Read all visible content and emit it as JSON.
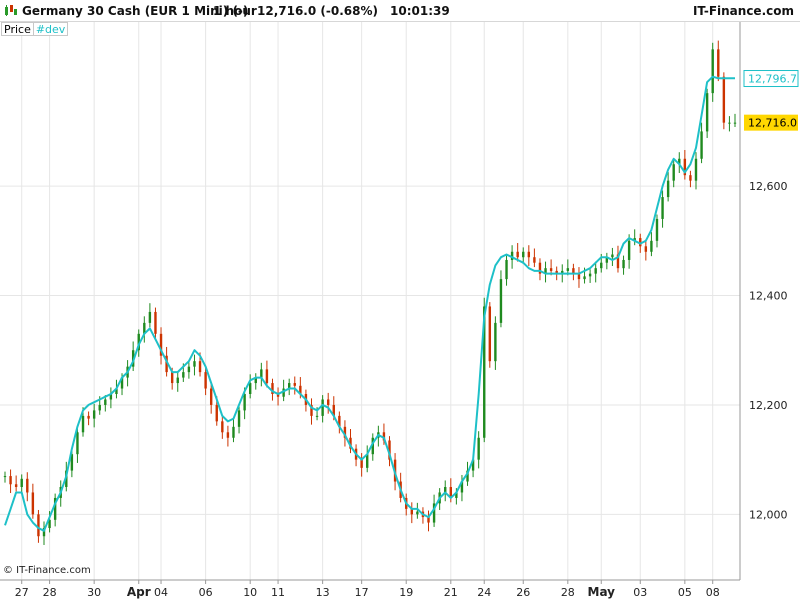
{
  "header": {
    "instrument": "Germany 30 Cash (EUR 1 Mini) (-)",
    "timeframe": "1 hour",
    "quote": "12,716.0 (-0.68%)",
    "time": "10:01:39",
    "brand": "IT-Finance.com"
  },
  "legend": {
    "price_label": "Price",
    "indicator_label": "#dev"
  },
  "footer": {
    "copyright": "© IT-Finance.com"
  },
  "colors": {
    "up": "#1f8a1f",
    "down": "#cc3300",
    "indicator": "#1ec0c8",
    "last_price_bg": "#ffd700",
    "grid": "#e6e6e6"
  },
  "chart_data": {
    "type": "line",
    "ylim": [
      11880,
      12900
    ],
    "y_ticks": [
      12000,
      12200,
      12400,
      12600
    ],
    "y_tick_labels": [
      "12,000",
      "12,200",
      "12,400",
      "12,600"
    ],
    "last_price": 12716.0,
    "last_price_label": "12,716.0",
    "indicator_value": 12796.7,
    "indicator_label": "12,796.7",
    "x_tick_labels": [
      "27",
      "28",
      "30",
      "Apr",
      "04",
      "06",
      "10",
      "11",
      "13",
      "17",
      "19",
      "21",
      "24",
      "26",
      "28",
      "May",
      "03",
      "05",
      "08"
    ],
    "x_tick_bold": [
      false,
      false,
      false,
      true,
      false,
      false,
      false,
      false,
      false,
      false,
      false,
      false,
      false,
      false,
      false,
      true,
      false,
      false,
      false
    ],
    "x_tick_index": [
      3,
      8,
      16,
      24,
      28,
      36,
      44,
      49,
      57,
      64,
      72,
      80,
      86,
      93,
      101,
      107,
      114,
      122,
      127
    ],
    "x_count": 132,
    "price_series": [
      12070,
      12055,
      12050,
      12065,
      12040,
      12000,
      11960,
      11975,
      11990,
      12030,
      12050,
      12080,
      12110,
      12150,
      12180,
      12175,
      12190,
      12200,
      12210,
      12220,
      12230,
      12250,
      12270,
      12300,
      12330,
      12350,
      12370,
      12330,
      12290,
      12260,
      12240,
      12250,
      12260,
      12270,
      12280,
      12260,
      12230,
      12200,
      12170,
      12150,
      12140,
      12160,
      12190,
      12220,
      12240,
      12250,
      12265,
      12240,
      12220,
      12215,
      12230,
      12240,
      12235,
      12220,
      12200,
      12180,
      12180,
      12210,
      12200,
      12180,
      12160,
      12140,
      12120,
      12100,
      12085,
      12110,
      12140,
      12150,
      12135,
      12100,
      12060,
      12030,
      12010,
      12000,
      12005,
      11995,
      11985,
      12020,
      12040,
      12050,
      12030,
      12040,
      12060,
      12080,
      12100,
      12140,
      12380,
      12280,
      12350,
      12430,
      12465,
      12480,
      12470,
      12480,
      12470,
      12460,
      12440,
      12450,
      12445,
      12440,
      12445,
      12450,
      12440,
      12430,
      12435,
      12440,
      12450,
      12460,
      12470,
      12475,
      12450,
      12465,
      12500,
      12505,
      12490,
      12480,
      12500,
      12540,
      12580,
      12610,
      12640,
      12650,
      12620,
      12610,
      12650,
      12700,
      12770,
      12850,
      12800,
      12716,
      12716,
      12716
    ],
    "indicator_series": [
      11980,
      12010,
      12040,
      12040,
      12000,
      11985,
      11975,
      11970,
      11995,
      12020,
      12040,
      12070,
      12120,
      12160,
      12190,
      12200,
      12205,
      12210,
      12215,
      12220,
      12230,
      12250,
      12260,
      12280,
      12310,
      12330,
      12340,
      12320,
      12300,
      12280,
      12260,
      12260,
      12270,
      12280,
      12300,
      12290,
      12270,
      12240,
      12210,
      12180,
      12170,
      12175,
      12200,
      12225,
      12245,
      12250,
      12250,
      12235,
      12225,
      12220,
      12225,
      12230,
      12230,
      12220,
      12210,
      12195,
      12190,
      12200,
      12195,
      12180,
      12160,
      12145,
      12125,
      12110,
      12100,
      12110,
      12130,
      12145,
      12140,
      12110,
      12075,
      12045,
      12020,
      12010,
      12010,
      12000,
      11995,
      12010,
      12030,
      12040,
      12030,
      12040,
      12060,
      12075,
      12100,
      12220,
      12360,
      12420,
      12455,
      12470,
      12475,
      12470,
      12465,
      12460,
      12450,
      12445,
      12445,
      12440,
      12440,
      12440,
      12440,
      12440,
      12440,
      12440,
      12445,
      12450,
      12460,
      12470,
      12470,
      12465,
      12470,
      12495,
      12505,
      12500,
      12495,
      12500,
      12520,
      12560,
      12600,
      12630,
      12650,
      12640,
      12625,
      12640,
      12670,
      12730,
      12790,
      12800,
      12797,
      12797,
      12797,
      12797
    ]
  }
}
